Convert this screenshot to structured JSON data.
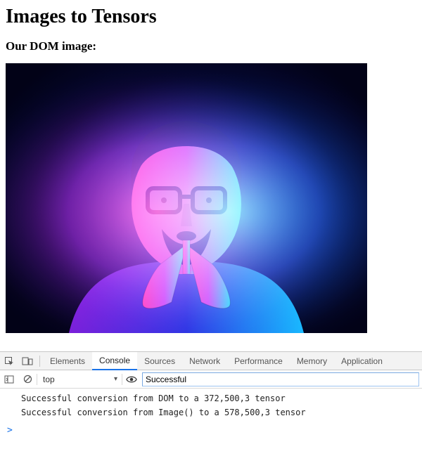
{
  "page": {
    "h1": "Images to Tensors",
    "h3": "Our DOM image:"
  },
  "devtools": {
    "tabs": {
      "elements": "Elements",
      "console": "Console",
      "sources": "Sources",
      "network": "Network",
      "performance": "Performance",
      "memory": "Memory",
      "application": "Application"
    },
    "toolbar": {
      "context": "top",
      "filter_value": "Successful"
    },
    "log": [
      "Successful conversion from DOM to a 372,500,3 tensor",
      "Successful conversion from Image() to a 578,500,3 tensor"
    ],
    "prompt": ">"
  },
  "icons": {
    "inspect": "inspect-icon",
    "device": "device-icon",
    "play": "play-icon",
    "clear": "clear-icon",
    "chevron_down": "▾",
    "eye": "eye-icon"
  }
}
